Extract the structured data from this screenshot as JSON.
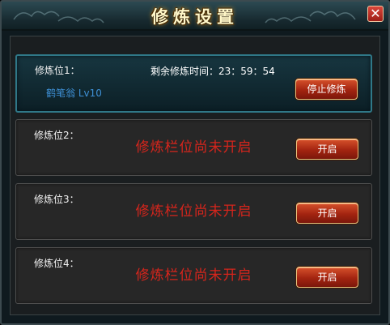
{
  "window": {
    "title": "修炼设置",
    "close_symbol": "✕"
  },
  "slots": [
    {
      "label": "修炼位1：",
      "character": "鹤笔翁 Lv10",
      "timer": "剩余修炼时间：23：59：54",
      "button_label": "停止修炼"
    },
    {
      "label": "修炼位2：",
      "status": "修炼栏位尚未开启",
      "button_label": "开启"
    },
    {
      "label": "修炼位3：",
      "status": "修炼栏位尚未开启",
      "button_label": "开启"
    },
    {
      "label": "修炼位4：",
      "status": "修炼栏位尚未开启",
      "button_label": "开启"
    }
  ],
  "colors": {
    "status_red": "#d6251c",
    "character_blue": "#3e90d6",
    "active_border": "#2f7888"
  }
}
